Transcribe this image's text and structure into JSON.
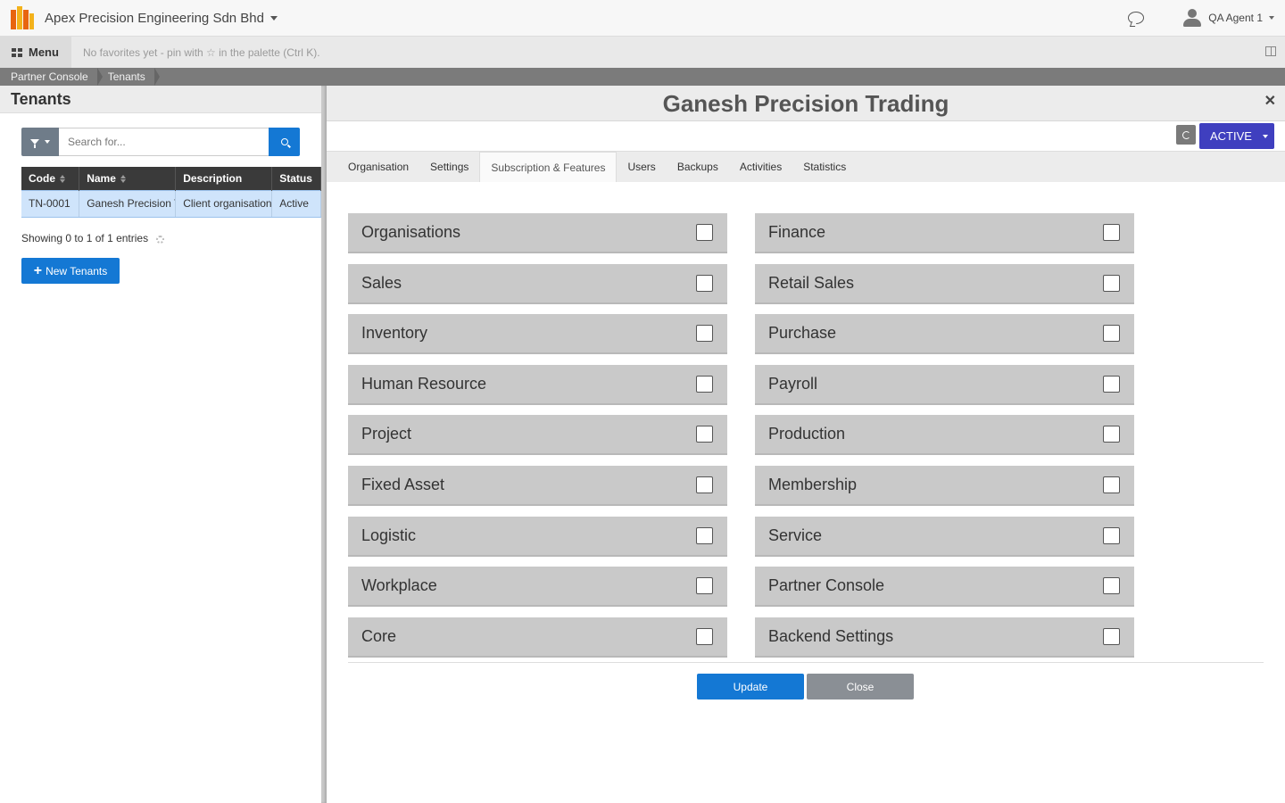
{
  "topbar": {
    "company": "Apex Precision Engineering Sdn Bhd",
    "user": "QA Agent 1"
  },
  "menubar": {
    "menu_label": "Menu",
    "favorites_hint": "No favorites yet - pin with ☆ in the palette (Ctrl K)."
  },
  "breadcrumb": [
    "Partner Console",
    "Tenants"
  ],
  "left": {
    "title": "Tenants",
    "search_placeholder": "Search for...",
    "columns": [
      "Code",
      "Name",
      "Description",
      "Status"
    ],
    "rows": [
      {
        "code": "TN-0001",
        "name": "Ganesh Precision Trading",
        "description": "Client organisation",
        "status": "Active"
      }
    ],
    "showing": "Showing 0 to 1 of 1 entries",
    "new_button": "New Tenants"
  },
  "record": {
    "title": "Ganesh Precision Trading",
    "status": "ACTIVE",
    "tabs": [
      "Organisation",
      "Settings",
      "Subscription & Features",
      "Users",
      "Backups",
      "Activities",
      "Statistics"
    ],
    "active_tab": "Subscription & Features",
    "features_left": [
      "Organisations",
      "Sales",
      "Inventory",
      "Human Resource",
      "Project",
      "Fixed Asset",
      "Logistic",
      "Workplace",
      "Core"
    ],
    "features_right": [
      "Finance",
      "Retail Sales",
      "Purchase",
      "Payroll",
      "Production",
      "Membership",
      "Service",
      "Partner Console",
      "Backend Settings"
    ],
    "update_label": "Update",
    "close_label": "Close"
  }
}
